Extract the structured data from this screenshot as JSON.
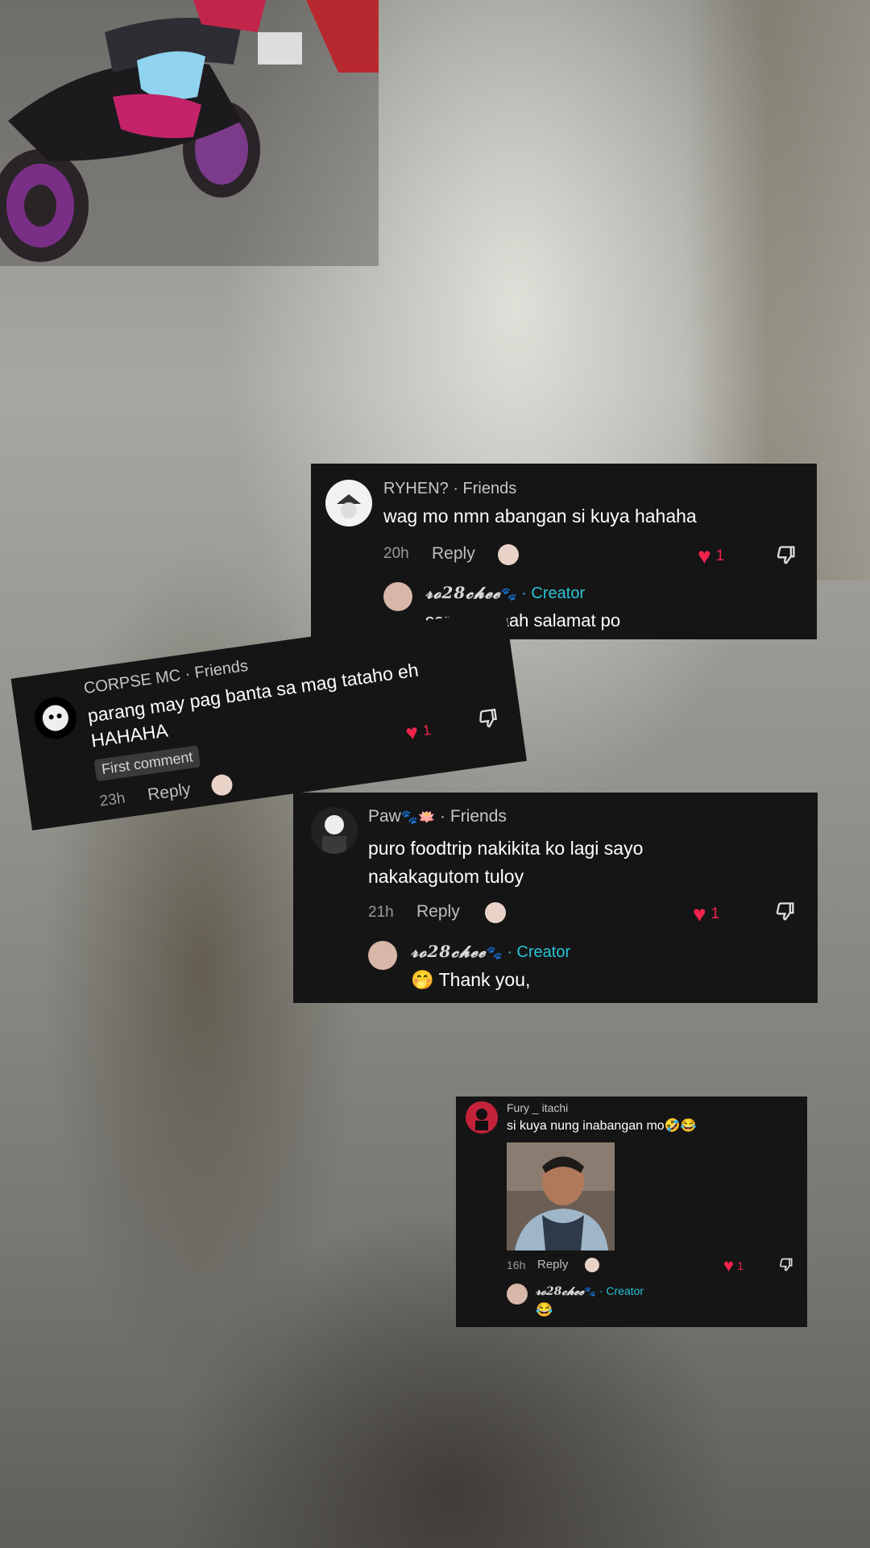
{
  "background": {
    "scene": "wet-road",
    "accent_heart": "#f1234d",
    "accent_creator": "#29c3d8"
  },
  "cards": {
    "ryhen": {
      "username": "RYHEN?",
      "relation": " · Friends",
      "text": "wag mo nmn abangan si kuya hahaha",
      "time": "20h",
      "reply_label": "Reply",
      "likes": "1",
      "reply": {
        "username": "𝓻𝓸28𝓬𝓱𝓮𝓮",
        "emoji": "🐾",
        "role": " · Creator",
        "text": "sorry ahhaah salamat po"
      }
    },
    "corpse": {
      "username": "CORPSE MC",
      "relation": " · Friends",
      "text": "parang may pag banta sa mag tataho eh HAHAHA",
      "badge": "First comment",
      "time": "23h",
      "reply_label": "Reply",
      "likes": "1"
    },
    "paw": {
      "username": "Paw",
      "emoji": "🐾🪷",
      "relation": " · Friends",
      "text": "puro foodtrip nakikita ko lagi sayo nakakagutom tuloy",
      "time": "21h",
      "reply_label": "Reply",
      "likes": "1",
      "reply": {
        "username": "𝓻𝓸28𝓬𝓱𝓮𝓮",
        "emoji": "🐾",
        "role": " · Creator",
        "text": "🤭 Thank you,"
      }
    },
    "fury": {
      "username": "Fury _ itachi",
      "text": "si kuya nung inabangan mo🤣😂",
      "time": "16h",
      "reply_label": "Reply",
      "likes": "1",
      "reply": {
        "username": "𝓻𝓸28𝓬𝓱𝓮𝓮",
        "emoji": "🐾",
        "role": " · Creator",
        "text": "😂"
      }
    }
  }
}
